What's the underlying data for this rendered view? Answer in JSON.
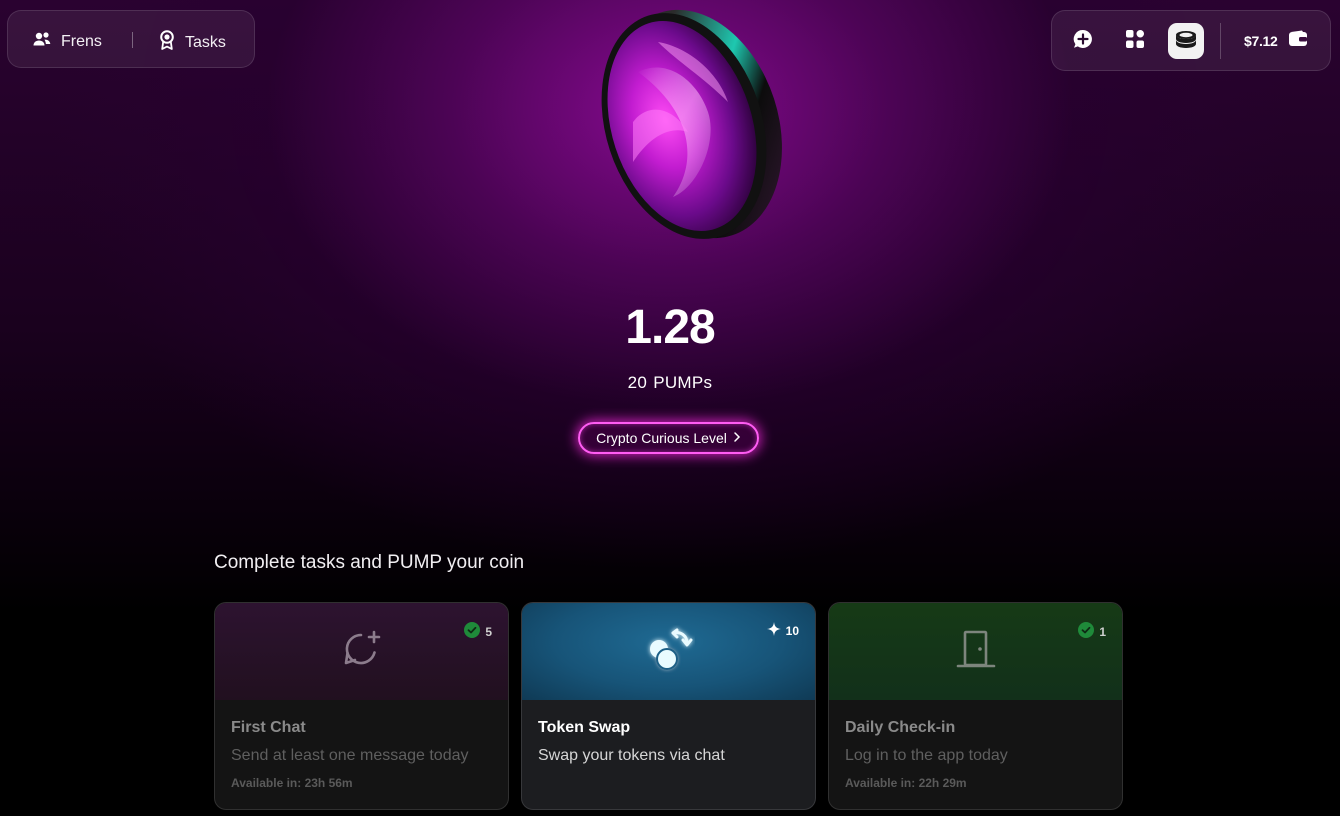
{
  "nav_left": {
    "frens_label": "Frens",
    "tasks_label": "Tasks",
    "frens_icon": "users-icon",
    "tasks_icon": "award-ribbon-icon"
  },
  "nav_right": {
    "wallet_balance": "$7.12",
    "icons": [
      "chat-plus-icon",
      "apps-grid-icon",
      "coins-stack-icon",
      "wallet-icon"
    ]
  },
  "hero": {
    "balance": "1.28",
    "pumps_count": "20",
    "pumps_unit": "PUMPs",
    "level_label": "Crypto Curious Level"
  },
  "tasks": {
    "section_title": "Complete tasks and PUMP your coin",
    "cards": [
      {
        "title": "First Chat",
        "description": "Send at least one message today",
        "available": "Available in: 23h 56m",
        "reward": "5",
        "status": "completed",
        "icon": "chat-add-icon"
      },
      {
        "title": "Token Swap",
        "description": "Swap your tokens via chat",
        "available": "",
        "reward": "10",
        "status": "active",
        "icon": "token-swap-icon"
      },
      {
        "title": "Daily Check-in",
        "description": "Log in to the app today",
        "available": "Available in: 22h 29m",
        "reward": "1",
        "status": "completed",
        "icon": "door-icon"
      }
    ]
  },
  "colors": {
    "accent_magenta": "#ff5cf3",
    "check_green": "#1f8a3a",
    "swap_blue": "#1f6a93"
  }
}
